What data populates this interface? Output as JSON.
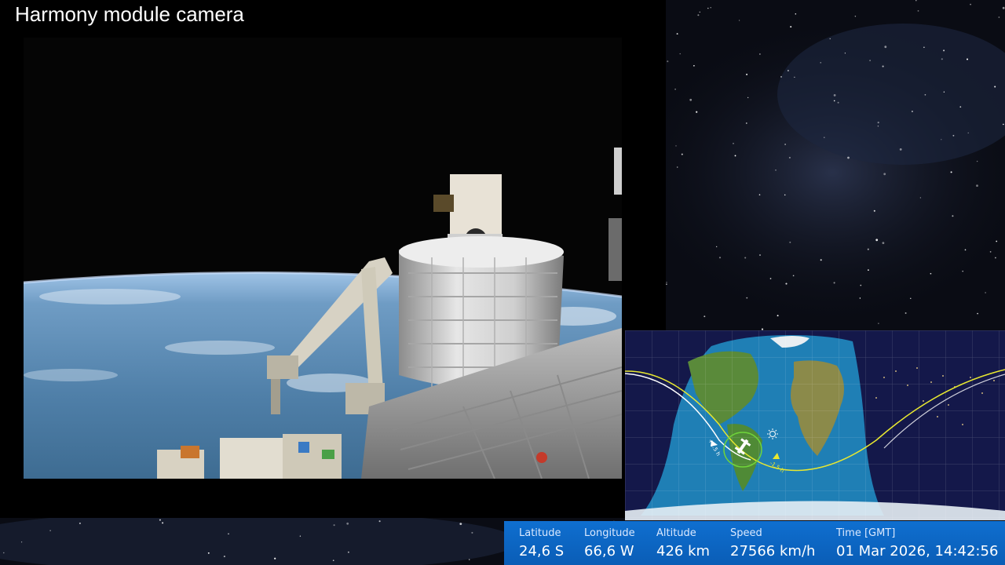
{
  "camera": {
    "title": "Harmony module camera"
  },
  "map": {
    "track_labels": {
      "minus": "-1.5 h",
      "plus": "+1.5 h"
    },
    "colors": {
      "past_track": "#ffffff",
      "future_track": "#e8e830",
      "ocean": "#1f7fb5",
      "night": "#14184a"
    },
    "icons": [
      "iss-icon",
      "sun-icon",
      "direction-arrow-icon"
    ]
  },
  "telemetry": {
    "latitude": {
      "label": "Latitude",
      "value": "24,6 S"
    },
    "longitude": {
      "label": "Longitude",
      "value": "66,6 W"
    },
    "altitude": {
      "label": "Altitude",
      "value": "426 km"
    },
    "speed": {
      "label": "Speed",
      "value": "27566 km/h"
    },
    "time": {
      "label": "Time [GMT]",
      "value": "01 Mar 2026, 14:42:56"
    }
  }
}
